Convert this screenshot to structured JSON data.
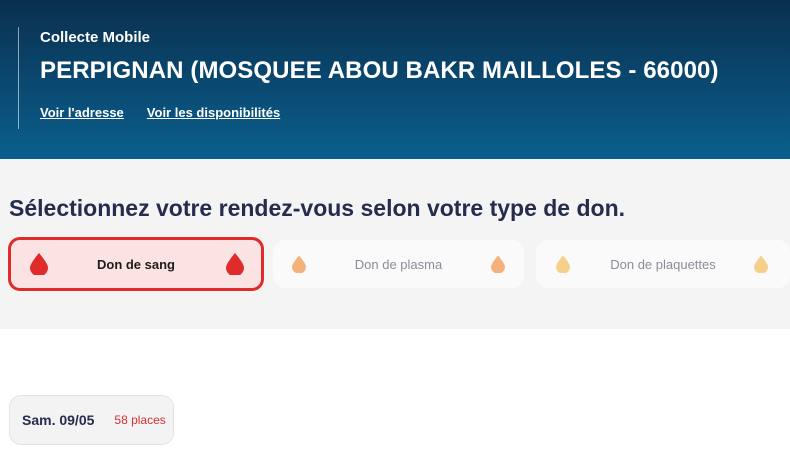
{
  "header": {
    "kicker": "Collecte Mobile",
    "title": "PERPIGNAN (MOSQUEE ABOU BAKR MAILLOLES - 66000)",
    "links": [
      {
        "label": "Voir l'adresse"
      },
      {
        "label": "Voir les disponibilités"
      }
    ]
  },
  "donation_types": {
    "heading": "Sélectionnez votre rendez-vous selon votre type de don.",
    "options": [
      {
        "label": "Don de sang",
        "selected": true,
        "icon": "blood-drop-icon",
        "color": "#e02b2b"
      },
      {
        "label": "Don de plasma",
        "selected": false,
        "icon": "plasma-drop-icon",
        "color": "#f3b27a"
      },
      {
        "label": "Don de plaquettes",
        "selected": false,
        "icon": "platelet-drop-icon",
        "color": "#f5d08a"
      }
    ]
  },
  "dates": [
    {
      "date": "Sam. 09/05",
      "places": "58 places"
    }
  ],
  "colors": {
    "header_dark": "#0b2f4e",
    "header_light": "#0a5f8d",
    "accent_red": "#e02b2b",
    "selected_bg": "#fbe3e3",
    "places_red": "#d8302f"
  }
}
